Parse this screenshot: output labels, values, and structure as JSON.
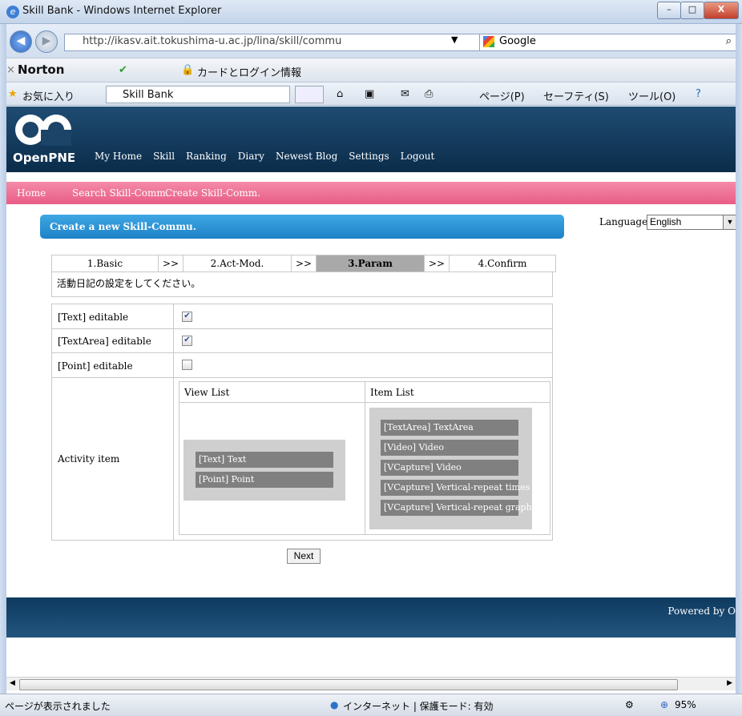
{
  "window": {
    "title": "Skill Bank - Windows Internet Explorer",
    "min_label": "–",
    "max_label": "□",
    "close_label": "X"
  },
  "address_bar": {
    "url": "http://ikasv.ait.tokushima-u.ac.jp/lina/skill/commu",
    "search_provider": "Google",
    "search_icon": "magnifier-icon"
  },
  "norton_bar": {
    "brand": "Norton",
    "password_manager": "カードとログイン情報"
  },
  "favorites_bar": {
    "favorites_label": "お気に入り",
    "tab_label": "Skill Bank",
    "page_menu": "ページ(P)",
    "safety_menu": "セーフティ(S)",
    "tools_menu": "ツール(O)"
  },
  "site": {
    "logo_text": "OpenPNE",
    "nav": [
      "My Home",
      "Skill",
      "Ranking",
      "Diary",
      "Newest Blog",
      "Settings",
      "Logout"
    ],
    "subnav": [
      "Home",
      "Search Skill-Comm.",
      "Create Skill-Comm."
    ],
    "section_title": "Create a new Skill-Commu.",
    "languages_label": "Languages:",
    "language_selected": "English"
  },
  "steps": {
    "items": [
      "1.Basic",
      ">>",
      "2.Act-Mod.",
      ">>",
      "3.Param",
      ">>",
      "4.Confirm"
    ],
    "active_index": 4,
    "note": "活動日記の設定をしてください。"
  },
  "form": {
    "rows": [
      {
        "label": "[Text] editable",
        "checked": true
      },
      {
        "label": "[TextArea] editable",
        "checked": true
      },
      {
        "label": "[Point] editable",
        "checked": false
      }
    ],
    "activity_label": "Activity item",
    "view_list_header": "View List",
    "item_list_header": "Item List",
    "view_list": [
      "[Text] Text",
      "[Point] Point"
    ],
    "item_list": [
      "[TextArea] TextArea",
      "[Video] Video",
      "[VCapture] Video",
      "[VCapture] Vertical-repeat times",
      "[VCapture] Vertical-repeat graph"
    ],
    "next_label": "Next"
  },
  "footer": {
    "powered_by": "Powered by O"
  },
  "status": {
    "left_text": "ページが表示されました",
    "zone_text": "インターネット | 保護モード: 有効",
    "zoom": "95%"
  }
}
